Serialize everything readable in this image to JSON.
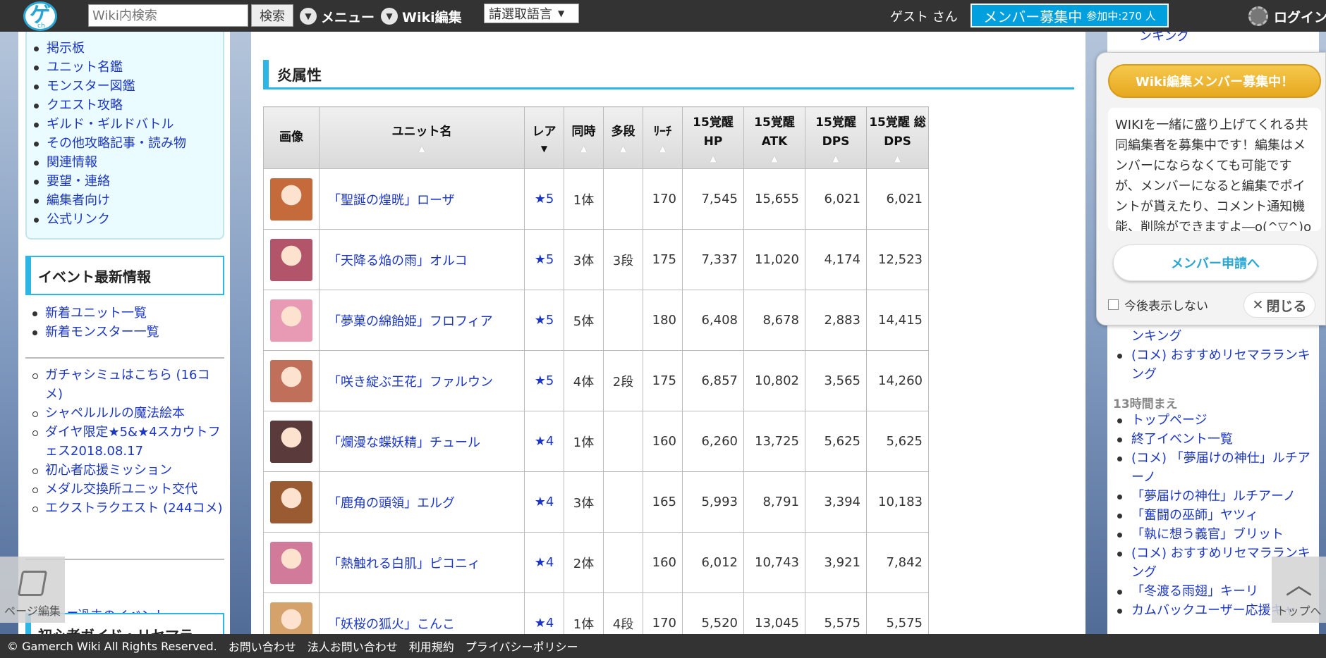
{
  "header": {
    "logo_text": "ゲ",
    "logo_sub": "ch",
    "search_placeholder": "Wiki内検索",
    "search_button": "検索",
    "menu_label": "メニュー",
    "wiki_edit_label": "Wiki編集",
    "lang_select": "請選取語言",
    "guest_label": "ゲスト さん",
    "recruit_label": "メンバー募集中",
    "recruit_count": "参加中:270 人",
    "login_label": "ログイン"
  },
  "left_sidebar": {
    "guide_items": [
      "掲示板",
      "ユニット名鑑",
      "モンスター図鑑",
      "クエスト攻略",
      "ギルド・ギルドバトル",
      "その他攻略記事・読み物",
      "関連情報",
      "要望・連絡",
      "編集者向け",
      "公式リンク"
    ],
    "event_heading": "イベント最新情報",
    "new_items": [
      "新着ユニット一覧",
      "新着モンスター一覧"
    ],
    "event_items": [
      "ガチャシミュはこちら (16コメ)",
      "シャペルルルの魔法絵本",
      "ダイヤ限定★5&★4スカウトフェス2018.08.17",
      "初心者応援ミッション",
      "メダル交換所ユニット交代",
      "エクストラクエスト (244コメ)"
    ],
    "past_events": "▼過去のイベント",
    "beginner_heading": "初心者ガイド・リセマラ"
  },
  "main": {
    "section_title": "炎属性",
    "columns": [
      "画像",
      "ユニット名",
      "レア",
      "同時",
      "多段",
      "ﾘｰﾁ",
      "15覚醒 HP",
      "15覚醒 ATK",
      "15覚醒 DPS",
      "15覚醒 総DPS"
    ],
    "rows": [
      {
        "name": "「聖誕の煌晄」ローザ",
        "rare": "★5",
        "simul": "1体",
        "multi": "",
        "reach": "170",
        "hp": "7,545",
        "atk": "15,655",
        "dps": "6,021",
        "total": "6,021",
        "color": "#c46a3b"
      },
      {
        "name": "「天降る焔の雨」オルコ",
        "rare": "★5",
        "simul": "3体",
        "multi": "3段",
        "reach": "175",
        "hp": "7,337",
        "atk": "11,020",
        "dps": "4,174",
        "total": "12,523",
        "color": "#b2556a"
      },
      {
        "name": "「夢菓の綿飴姫」フロフィア",
        "rare": "★5",
        "simul": "5体",
        "multi": "",
        "reach": "180",
        "hp": "6,408",
        "atk": "8,678",
        "dps": "2,883",
        "total": "14,415",
        "color": "#e89ab4"
      },
      {
        "name": "「咲き綻ぶ王花」ファルウン",
        "rare": "★5",
        "simul": "4体",
        "multi": "2段",
        "reach": "175",
        "hp": "6,857",
        "atk": "10,802",
        "dps": "3,565",
        "total": "14,260",
        "color": "#c0705a"
      },
      {
        "name": "「爛漫な蝶妖精」チュール",
        "rare": "★4",
        "simul": "1体",
        "multi": "",
        "reach": "160",
        "hp": "6,260",
        "atk": "13,725",
        "dps": "5,625",
        "total": "5,625",
        "color": "#5a3a3a"
      },
      {
        "name": "「鹿角の頭領」エルグ",
        "rare": "★4",
        "simul": "3体",
        "multi": "",
        "reach": "165",
        "hp": "5,993",
        "atk": "8,791",
        "dps": "3,394",
        "total": "10,183",
        "color": "#9a5a32"
      },
      {
        "name": "「熱触れる白肌」ピコニィ",
        "rare": "★4",
        "simul": "2体",
        "multi": "",
        "reach": "160",
        "hp": "6,012",
        "atk": "10,743",
        "dps": "3,921",
        "total": "7,842",
        "color": "#d27a9a"
      },
      {
        "name": "「妖桜の狐火」こんこ",
        "rare": "★4",
        "simul": "1体",
        "multi": "4段",
        "reach": "170",
        "hp": "5,520",
        "atk": "13,045",
        "dps": "5,575",
        "total": "5,575",
        "color": "#d4a26a"
      }
    ]
  },
  "right_sidebar": {
    "top_link": "ンキング",
    "popup": {
      "title": "Wiki編集メンバー募集中！",
      "body": "WIKIを一緒に盛り上げてくれる共同編集者を募集中です！編集はメンバーにならなくても可能ですが、メンバーになると編集でポイントが貰えたり、コメント通知機能、削除ができますよ―o(^▽^)o",
      "apply": "メンバー申請へ",
      "dont_show": "今後表示しない",
      "close": "閉じる"
    },
    "cont_line": "ンキング",
    "list_1": [
      "(コメ) おすすめリセマラランキング"
    ],
    "time_label": "13時間まえ",
    "list_2": [
      "トップページ",
      "終了イベント一覧",
      "(コメ) 「夢届けの神仕」ルチアーノ",
      "「夢届けの神仕」ルチアーノ",
      "「奮闘の巫師」ヤツィ",
      "「執に想う義官」ブリット",
      "(コメ) おすすめリセマラランキング",
      "「冬渡る雨翅」キーリ",
      "カムバックユーザー応援キャ"
    ]
  },
  "floating": {
    "page_edit": "ページ編集",
    "to_top": "トップへ"
  },
  "footer": {
    "copyright": "© Gamerch Wiki All Rights Reserved.",
    "links": [
      "お問い合わせ",
      "法人お問い合わせ",
      "利用規約",
      "プライバシーポリシー"
    ]
  }
}
